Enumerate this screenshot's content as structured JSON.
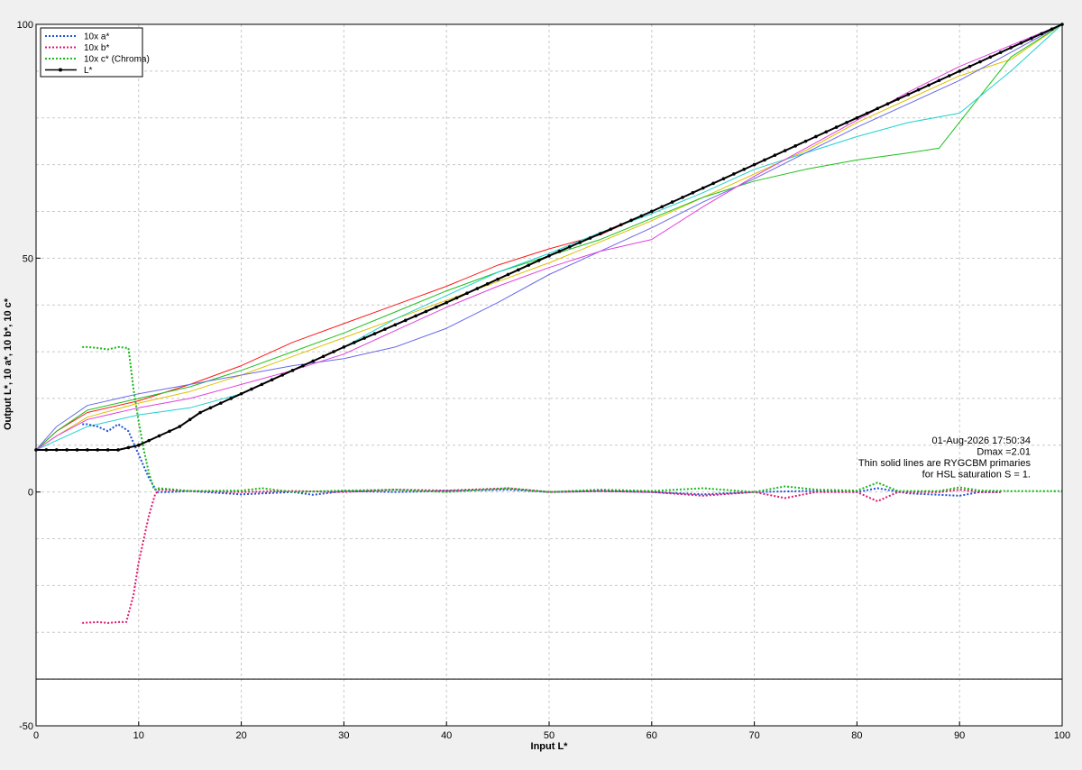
{
  "chart_data": {
    "type": "line",
    "xlabel": "Input L*",
    "ylabel": "Output L*, 10 a*, 10 b*, 10 c*",
    "xlim": [
      0,
      100
    ],
    "ylim": [
      -50,
      100
    ],
    "lower_panel_boundary": -40,
    "grid": true,
    "x_ticks": [
      "0",
      "10",
      "20",
      "30",
      "40",
      "50",
      "60",
      "70",
      "80",
      "90",
      "100"
    ],
    "y_ticks": [
      "-50",
      "0",
      "50",
      "100"
    ],
    "legend": {
      "placement": "top-left",
      "entries": [
        {
          "label": "10x a*",
          "color": "#1e50d8",
          "style": "dotted"
        },
        {
          "label": "10x b*",
          "color": "#e0186c",
          "style": "dotted"
        },
        {
          "label": "10x c* (Chroma)",
          "color": "#18b818",
          "style": "dotted"
        },
        {
          "label": "L*",
          "color": "#000000",
          "style": "solid-marker"
        }
      ]
    },
    "annotation": {
      "lines": [
        "01-Aug-2026 17:50:34",
        "Dmax =2.01",
        "Thin solid lines are RYGCBM primaries",
        "for HSL saturation S = 1."
      ]
    },
    "series": [
      {
        "name": "L*",
        "color": "#000000",
        "x": [
          0,
          4,
          8,
          10,
          12,
          14,
          16,
          20,
          30,
          40,
          50,
          60,
          70,
          80,
          90,
          100
        ],
        "y": [
          9,
          9,
          9,
          10,
          12,
          14,
          17,
          21,
          31,
          40.5,
          50.5,
          60,
          70,
          80,
          90,
          100
        ]
      },
      {
        "name": "10x a*",
        "color": "#1e50d8",
        "x": [
          4.5,
          5,
          6,
          7,
          8,
          9,
          10,
          11,
          11.8,
          13,
          15,
          20,
          25,
          27,
          30,
          35,
          40,
          46,
          50,
          55,
          60,
          65,
          70,
          75,
          80,
          82,
          85,
          90,
          92,
          94
        ],
        "y": [
          14.5,
          14.5,
          14,
          13,
          14.5,
          13,
          8,
          3,
          0,
          0,
          0.2,
          -0.5,
          0,
          -0.6,
          0.2,
          0,
          0.2,
          0.5,
          0,
          0.2,
          0,
          -0.5,
          0,
          0.2,
          0,
          0.8,
          -0.3,
          -0.8,
          0,
          0
        ]
      },
      {
        "name": "10x b*",
        "color": "#e0186c",
        "x": [
          4.5,
          6,
          7,
          8,
          8.8,
          9.5,
          10,
          10.5,
          11,
          11.6,
          12,
          15,
          20,
          25,
          30,
          35,
          40,
          46,
          50,
          55,
          60,
          65,
          70,
          73,
          76,
          80,
          82,
          84,
          88,
          90,
          92,
          94
        ],
        "y": [
          -28,
          -27.8,
          -28,
          -27.8,
          -27.8,
          -22,
          -15,
          -10,
          -5,
          -0.5,
          0.5,
          0.2,
          0,
          0.2,
          0,
          0.5,
          0.3,
          0.8,
          0,
          0.2,
          0,
          -0.8,
          0,
          -1.3,
          0,
          0,
          -2,
          0,
          0,
          0.5,
          0,
          0
        ]
      },
      {
        "name": "10x c* (Chroma)",
        "color": "#18b818",
        "x": [
          4.5,
          5,
          6,
          7,
          8,
          9,
          9.5,
          10,
          10.5,
          11,
          11.5,
          12,
          15,
          20,
          22,
          25,
          30,
          35,
          40,
          46,
          50,
          55,
          60,
          65,
          70,
          73,
          76,
          80,
          82,
          84,
          88,
          90,
          92,
          95,
          100
        ],
        "y": [
          31,
          31,
          30.8,
          30.5,
          31,
          30.8,
          22,
          15,
          9,
          4,
          0.5,
          0.8,
          0.2,
          0.3,
          0.8,
          0,
          0.3,
          0.5,
          0,
          0.8,
          0,
          0.5,
          0.2,
          0.8,
          0,
          1.2,
          0.5,
          0.3,
          2,
          0.2,
          0.2,
          1,
          0.3,
          0.2,
          0.2
        ]
      },
      {
        "name": "R",
        "color": "#ff1818",
        "x": [
          0,
          2,
          5,
          10,
          15,
          20,
          25,
          30,
          35,
          40,
          45,
          50,
          55,
          60,
          65,
          70,
          75,
          80,
          85,
          90,
          95,
          100
        ],
        "y": [
          9,
          13,
          17,
          19.5,
          23,
          27,
          32,
          36,
          40,
          44,
          48.5,
          52,
          55,
          60,
          65,
          70,
          75,
          80,
          85,
          90,
          95,
          100
        ]
      },
      {
        "name": "Y",
        "color": "#e0c000",
        "x": [
          0,
          2,
          5,
          10,
          15,
          20,
          25,
          30,
          35,
          40,
          45,
          50,
          55,
          60,
          65,
          70,
          75,
          80,
          85,
          90,
          95,
          100
        ],
        "y": [
          9,
          12,
          16,
          19,
          21.5,
          25,
          29,
          33,
          37,
          41,
          45,
          49,
          53.5,
          58,
          63,
          68,
          73,
          79,
          84,
          89,
          92.5,
          100
        ]
      },
      {
        "name": "G",
        "color": "#1cc01c",
        "x": [
          0,
          2,
          5,
          10,
          15,
          20,
          25,
          30,
          35,
          40,
          45,
          50,
          55,
          60,
          65,
          70,
          75,
          80,
          85,
          88,
          95,
          100
        ],
        "y": [
          9,
          13,
          17.5,
          20,
          22.5,
          26,
          30,
          34,
          38.5,
          43,
          47,
          50.5,
          54,
          58.5,
          63,
          66.5,
          69,
          71,
          72.5,
          73.5,
          93,
          100
        ]
      },
      {
        "name": "C",
        "color": "#20d0d0",
        "x": [
          0,
          2,
          5,
          10,
          15,
          20,
          25,
          30,
          35,
          40,
          45,
          50,
          55,
          60,
          65,
          70,
          75,
          80,
          85,
          90,
          95,
          100
        ],
        "y": [
          9,
          11,
          14,
          16.5,
          18,
          21,
          26,
          31,
          37,
          42,
          47,
          51,
          55.5,
          59.5,
          64,
          69,
          72.5,
          76,
          79,
          81,
          90,
          100
        ]
      },
      {
        "name": "B",
        "color": "#6a6ae8",
        "x": [
          0,
          2,
          5,
          10,
          15,
          20,
          25,
          30,
          35,
          40,
          45,
          50,
          55,
          60,
          65,
          70,
          75,
          80,
          85,
          90,
          95,
          100
        ],
        "y": [
          9,
          14,
          18.5,
          21,
          23,
          25,
          27,
          28.5,
          31,
          35,
          40.5,
          46.5,
          51.5,
          56.5,
          62,
          67,
          72.5,
          78,
          83,
          88,
          94,
          100
        ]
      },
      {
        "name": "M",
        "color": "#e040e0",
        "x": [
          0,
          2,
          5,
          10,
          15,
          20,
          25,
          30,
          35,
          40,
          45,
          50,
          55,
          60,
          65,
          70,
          75,
          80,
          85,
          90,
          95,
          100
        ],
        "y": [
          9,
          12,
          15.5,
          18,
          20,
          23,
          26,
          29.5,
          34.5,
          39.5,
          44,
          48,
          51.5,
          54,
          61,
          67.5,
          73.5,
          79.5,
          85.5,
          91,
          95.5,
          100
        ]
      }
    ]
  }
}
